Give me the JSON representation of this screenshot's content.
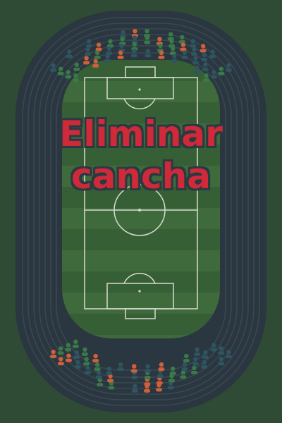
{
  "title": {
    "line1": "Eliminar",
    "line2": "cancha"
  },
  "colors": {
    "background": "#2f4a35",
    "track": "#2a3640",
    "track_lane": "#3a4852",
    "pitch_light": "#3f6a3c",
    "pitch_dark": "#375f35",
    "lines": "#d8dcd0",
    "title": "#d02a3a",
    "fan_orange": "#d0603a",
    "fan_green": "#3a7a48",
    "fan_teal": "#2f5560"
  },
  "icons": {
    "fans": "person-icon",
    "pitch": "soccer-field-icon"
  }
}
